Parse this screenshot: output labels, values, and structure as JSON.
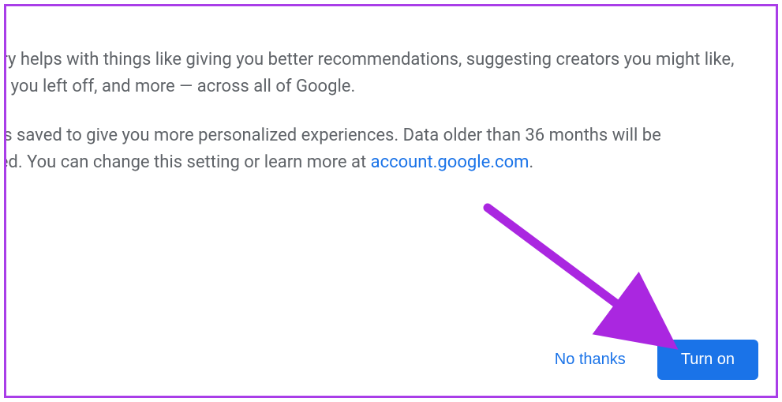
{
  "dialog": {
    "paragraph1": "Your YouTube history helps with things like giving you better recommendations, suggesting creators you might like, remembering where you left off, and more — across all of Google.",
    "paragraph2_prefix": "When on, this data is saved to give you more personalized experiences. Data older than 36 months will be automatically deleted. You can change this setting or learn more at ",
    "link_text": "account.google.com",
    "paragraph2_suffix": "."
  },
  "buttons": {
    "no_thanks": "No thanks",
    "turn_on": "Turn on"
  },
  "annotation": {
    "arrow_color": "#aa27e0"
  }
}
